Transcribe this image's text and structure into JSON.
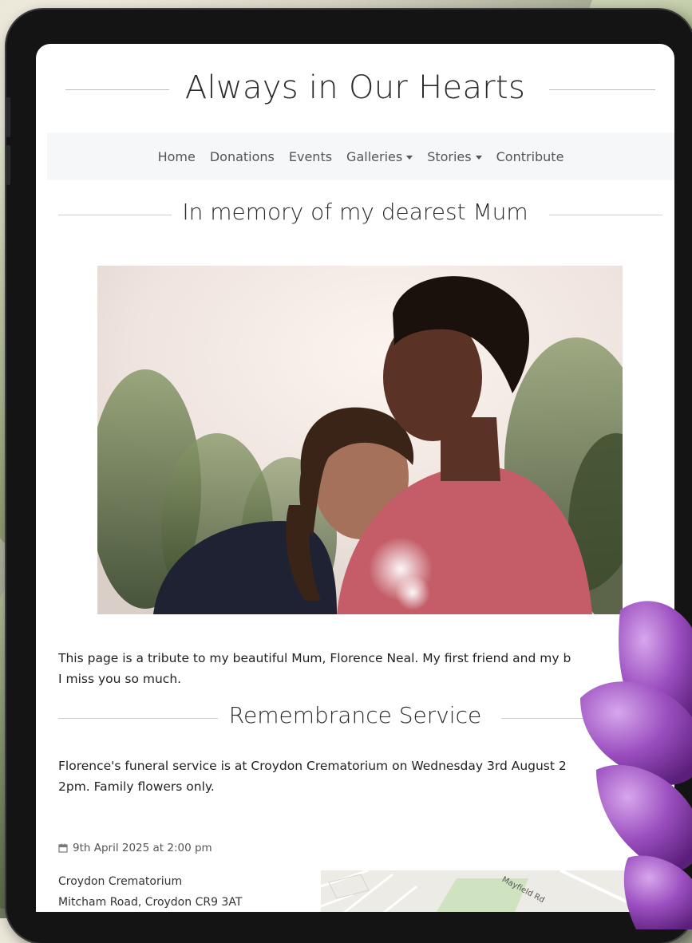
{
  "site": {
    "title": "Always in Our Hearts"
  },
  "nav": {
    "items": [
      {
        "label": "Home",
        "dropdown": false
      },
      {
        "label": "Donations",
        "dropdown": false
      },
      {
        "label": "Events",
        "dropdown": false
      },
      {
        "label": "Galleries",
        "dropdown": true
      },
      {
        "label": "Stories",
        "dropdown": true
      },
      {
        "label": "Contribute",
        "dropdown": false
      }
    ]
  },
  "tribute": {
    "heading": "In memory of my dearest Mum",
    "text": "This page is a tribute to my beautiful Mum, Florence Neal. My first friend and my b\nI miss you so much."
  },
  "service": {
    "heading": "Remembrance Service",
    "text": "Florence's funeral service is at Croydon Crematorium on Wednesday 3rd August 2\n2pm. Family flowers only.",
    "date": "9th April 2025 at 2:00 pm",
    "address_line1": "Croydon Crematorium",
    "address_line2": "Mitcham Road, Croydon CR9 3AT",
    "map_label": "Mayfield Rd"
  },
  "icons": {
    "calendar": "calendar-icon",
    "dropdown": "caret-down-icon"
  },
  "colors": {
    "nav_bg": "#f5f7f8",
    "text": "#222222",
    "muted": "#555555",
    "rule": "#cfcfcf"
  }
}
